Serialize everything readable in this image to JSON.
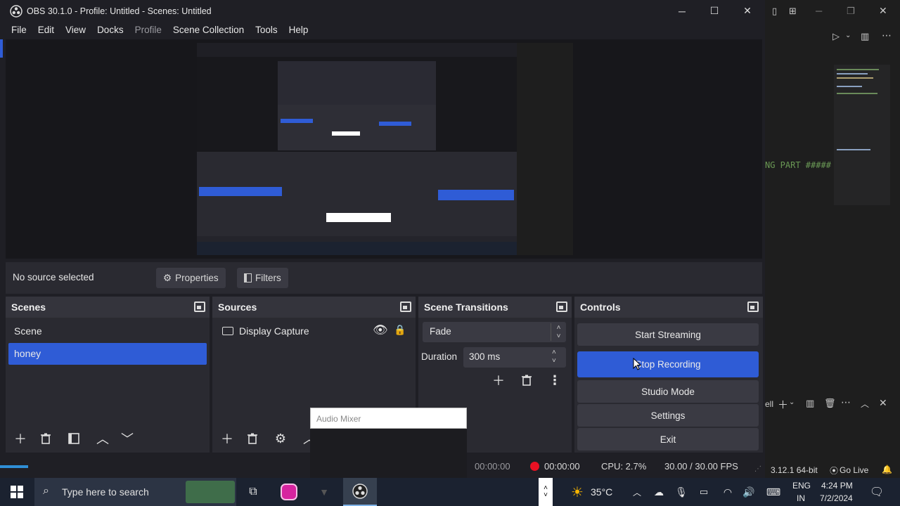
{
  "window": {
    "title": "OBS 30.1.0 - Profile: Untitled - Scenes: Untitled"
  },
  "menu": {
    "items": [
      "File",
      "Edit",
      "View",
      "Docks",
      "Profile",
      "Scene Collection",
      "Tools",
      "Help"
    ]
  },
  "source_bar": {
    "no_source": "No source selected",
    "properties": "Properties",
    "filters": "Filters"
  },
  "scenes": {
    "title": "Scenes",
    "items": [
      "Scene",
      "honey"
    ],
    "selected": "honey"
  },
  "sources": {
    "title": "Sources",
    "items": [
      "Display Capture"
    ]
  },
  "transitions": {
    "title": "Scene Transitions",
    "transition": "Fade",
    "duration_label": "Duration",
    "duration_value": "300 ms"
  },
  "controls": {
    "title": "Controls",
    "start_streaming": "Start Streaming",
    "stop_recording": "Stop Recording",
    "studio_mode": "Studio Mode",
    "settings": "Settings",
    "exit": "Exit"
  },
  "audio_mixer": {
    "title": "Audio Mixer"
  },
  "status": {
    "stream_time": "00:00:00",
    "rec_time": "00:00:00",
    "cpu": "CPU: 2.7%",
    "fps": "30.00 / 30.00 FPS"
  },
  "right_pane": {
    "code_fragment": "NG PART #####",
    "python_version": "3.12.1 64-bit",
    "go_live": "Go Live"
  },
  "taskbar": {
    "search_placeholder": "Type here to search",
    "weather": "35°C",
    "lang_top": "ENG",
    "lang_bottom": "IN",
    "time": "4:24 PM",
    "date": "7/2/2024"
  },
  "colors": {
    "accent": "#2f5cd6",
    "recording_red": "#e81123"
  }
}
